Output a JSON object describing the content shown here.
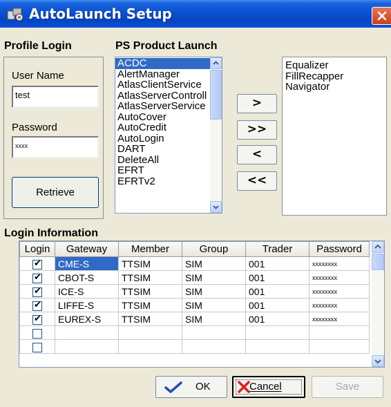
{
  "window": {
    "title": "AutoLaunch Setup",
    "icon": "autolaunch-app-icon",
    "close_icon": "close-icon"
  },
  "profile_login": {
    "caption": "Profile Login",
    "username_label": "User Name",
    "username_value": "test",
    "password_label": "Password",
    "password_value": "xxxx",
    "retrieve_label": "Retrieve"
  },
  "ps_product_launch": {
    "caption": "PS Product Launch",
    "available": [
      "ACDC",
      "AlertManager",
      "AtlasClientService",
      "AtlasServerControll",
      "AtlasServerService",
      "AutoCover",
      "AutoCredit",
      "AutoLogin",
      "DART",
      "DeleteAll",
      "EFRT",
      "EFRTv2"
    ],
    "selected_index": 0,
    "chosen": [
      "Equalizer",
      "FillRecapper",
      "Navigator"
    ],
    "buttons": {
      "add_one": ">",
      "add_all": ">>",
      "remove_one": "<",
      "remove_all": "<<"
    }
  },
  "login_information": {
    "caption": "Login Information",
    "columns": [
      "Login",
      "Gateway",
      "Member",
      "Group",
      "Trader",
      "Password"
    ],
    "rows": [
      {
        "checked": true,
        "gateway": "CME-S",
        "member": "TTSIM",
        "group": "SIM",
        "trader": "001",
        "password": "xxxxxxxx"
      },
      {
        "checked": true,
        "gateway": "CBOT-S",
        "member": "TTSIM",
        "group": "SIM",
        "trader": "001",
        "password": "xxxxxxxx"
      },
      {
        "checked": true,
        "gateway": "ICE-S",
        "member": "TTSIM",
        "group": "SIM",
        "trader": "001",
        "password": "xxxxxxxx"
      },
      {
        "checked": true,
        "gateway": "LIFFE-S",
        "member": "TTSIM",
        "group": "SIM",
        "trader": "001",
        "password": "xxxxxxxx"
      },
      {
        "checked": true,
        "gateway": "EUREX-S",
        "member": "TTSIM",
        "group": "SIM",
        "trader": "001",
        "password": "xxxxxxxx"
      },
      {
        "checked": false,
        "gateway": "",
        "member": "",
        "group": "",
        "trader": "",
        "password": ""
      },
      {
        "checked": false,
        "gateway": "",
        "member": "",
        "group": "",
        "trader": "",
        "password": ""
      }
    ]
  },
  "footer": {
    "ok_label": "OK",
    "cancel_label": "Cancel",
    "save_label": "Save"
  },
  "colors": {
    "titlebar": "#0a50d0",
    "selection": "#316ac5",
    "dialog_bg": "#ece9d8",
    "ok_check": "#1d4fb8",
    "cancel_x": "#e02020"
  }
}
